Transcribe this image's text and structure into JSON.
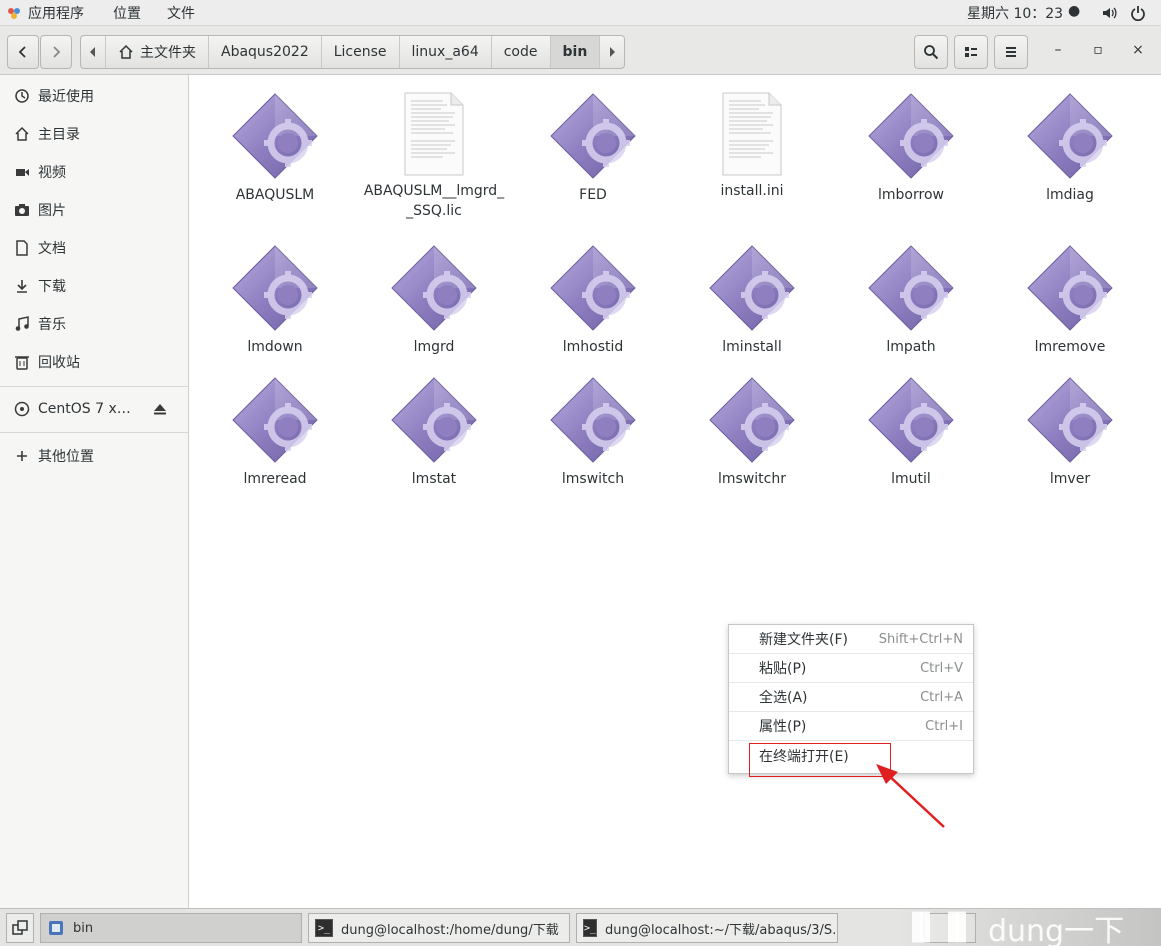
{
  "topbar": {
    "apps_label": "应用程序",
    "places_label": "位置",
    "file_label": "文件",
    "clock": "星期六 10：23",
    "volume_icon": "volume-icon",
    "power_icon": "power-icon"
  },
  "header": {
    "breadcrumbs": [
      "主文件夹",
      "Abaqus2022",
      "License",
      "linux_a64",
      "code",
      "bin"
    ],
    "window_controls": [
      "–",
      "▫",
      "×"
    ]
  },
  "sidebar": {
    "items": [
      {
        "label": "最近使用",
        "icon": "clock-icon"
      },
      {
        "label": "主目录",
        "icon": "home-icon"
      },
      {
        "label": "视频",
        "icon": "video-icon"
      },
      {
        "label": "图片",
        "icon": "camera-icon"
      },
      {
        "label": "文档",
        "icon": "document-icon"
      },
      {
        "label": "下载",
        "icon": "download-icon"
      },
      {
        "label": "音乐",
        "icon": "music-icon"
      },
      {
        "label": "回收站",
        "icon": "trash-icon"
      }
    ],
    "device": {
      "label": "CentOS 7 x…",
      "icon": "disc-icon",
      "eject_icon": "eject-icon"
    },
    "other": {
      "label": "其他位置",
      "icon": "plus-icon"
    }
  },
  "files": [
    {
      "name": "ABAQUSLM",
      "type": "exec"
    },
    {
      "name": "ABAQUSLM__lmgrd_\n_SSQ.lic",
      "type": "doc"
    },
    {
      "name": "FED",
      "type": "exec"
    },
    {
      "name": "install.ini",
      "type": "doc"
    },
    {
      "name": "lmborrow",
      "type": "exec"
    },
    {
      "name": "lmdiag",
      "type": "exec"
    },
    {
      "name": "lmdown",
      "type": "exec"
    },
    {
      "name": "lmgrd",
      "type": "exec"
    },
    {
      "name": "lmhostid",
      "type": "exec"
    },
    {
      "name": "lminstall",
      "type": "exec"
    },
    {
      "name": "lmpath",
      "type": "exec"
    },
    {
      "name": "lmremove",
      "type": "exec"
    },
    {
      "name": "lmreread",
      "type": "exec"
    },
    {
      "name": "lmstat",
      "type": "exec"
    },
    {
      "name": "lmswitch",
      "type": "exec"
    },
    {
      "name": "lmswitchr",
      "type": "exec"
    },
    {
      "name": "lmutil",
      "type": "exec"
    },
    {
      "name": "lmver",
      "type": "exec"
    }
  ],
  "context_menu": {
    "items": [
      {
        "label": "新建文件夹(F)",
        "shortcut": "Shift+Ctrl+N"
      },
      {
        "label": "粘贴(P)",
        "shortcut": "Ctrl+V"
      },
      {
        "label": "全选(A)",
        "shortcut": "Ctrl+A"
      },
      {
        "label": "属性(P)",
        "shortcut": "Ctrl+I"
      },
      {
        "label": "在终端打开(E)",
        "shortcut": ""
      }
    ]
  },
  "taskbar": {
    "tasks": [
      {
        "label": "bin",
        "active": true
      },
      {
        "label": "dung@localhost:/home/dung/下载",
        "active": false
      },
      {
        "label": "dung@localhost:~/下载/abaqus/3/S…",
        "active": false
      }
    ],
    "watermark": "dung一下"
  },
  "colors": {
    "annotation_red": "#e02020",
    "exec_icon_purple": "#8f7fc1"
  }
}
